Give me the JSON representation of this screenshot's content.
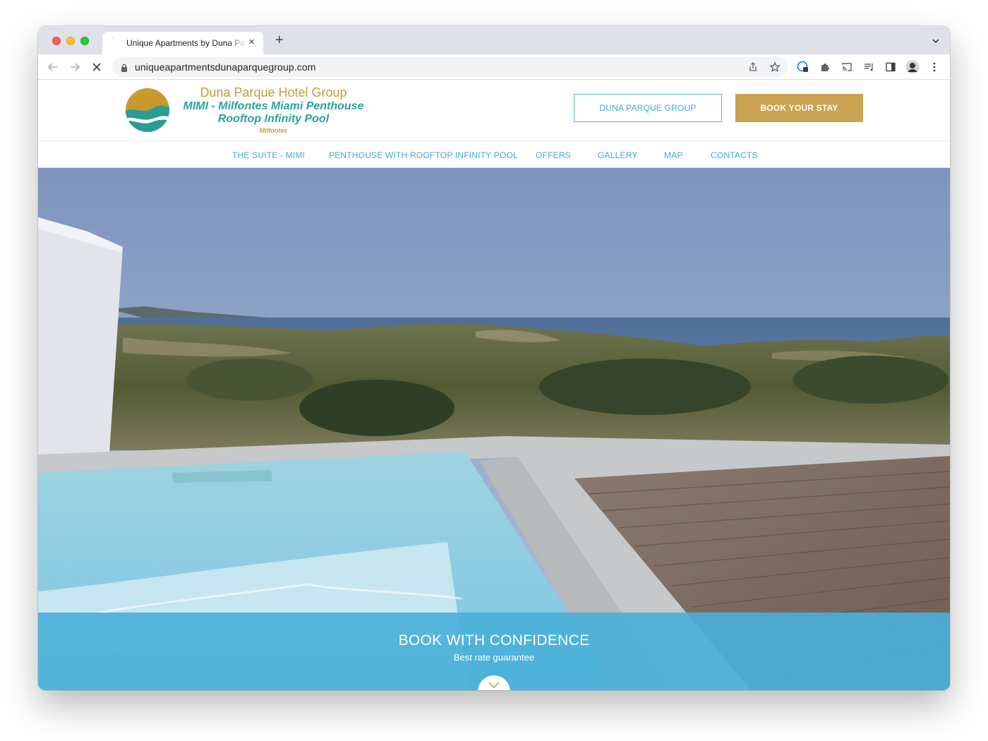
{
  "browser": {
    "tab_title": "Unique Apartments by Duna Parque",
    "tab_close": "×",
    "new_tab": "+",
    "url": "uniqueapartmentsdunaparquegroup.com"
  },
  "header": {
    "logo_line1": "Duna Parque Hotel Group",
    "logo_line2": "MIMI - Milfontes Miami Penthouse",
    "logo_line3": "Rooftop Infinity Pool",
    "logo_line4": "Milfontes",
    "btn_group": "DUNA PARQUE GROUP",
    "btn_book": "BOOK YOUR STAY"
  },
  "nav": {
    "items": [
      "THE SUITE - MIMI",
      "PENTHOUSE WITH ROOFTOP INFINITY POOL",
      "OFFERS",
      "GALLERY",
      "MAP",
      "CONTACTS"
    ]
  },
  "hero": {
    "banner_title": "BOOK WITH CONFIDENCE",
    "banner_subtitle": "Best rate guarantee"
  },
  "colors": {
    "accent_blue": "#3eaad0",
    "gold": "#c9a352",
    "teal": "#2aa39a",
    "banner": "#4ab0d9"
  }
}
